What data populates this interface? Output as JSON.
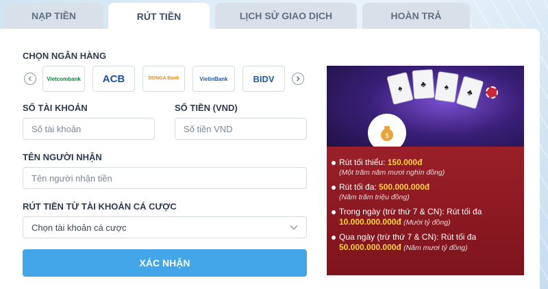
{
  "tabs": [
    {
      "label": "NẠP TIỀN",
      "active": false
    },
    {
      "label": "RÚT TIỀN",
      "active": true
    },
    {
      "label": "LỊCH SỬ GIAO DỊCH",
      "active": false
    },
    {
      "label": "HOÀN TRẢ",
      "active": false
    }
  ],
  "bank_section": {
    "label": "CHỌN NGÂN HÀNG",
    "banks": [
      {
        "name": "Vietcombank",
        "color": "#1a7a3c"
      },
      {
        "name": "ACB",
        "color": "#1f4fa3"
      },
      {
        "name": "DONGA Bank",
        "color": "#e88a18"
      },
      {
        "name": "VietinBank",
        "color": "#1c5aa8"
      },
      {
        "name": "BIDV",
        "color": "#1d5aa7"
      }
    ]
  },
  "form": {
    "account_number": {
      "label": "SỐ TÀI KHOẢN",
      "placeholder": "Số tài khoản"
    },
    "amount": {
      "label": "SỐ TIỀN (VND)",
      "placeholder": "Số tiền VND"
    },
    "recipient": {
      "label": "TÊN NGƯỜI NHẬN",
      "placeholder": "Tên người nhận tiền"
    },
    "source_account": {
      "label": "RÚT TIỀN TỪ TÀI KHOẢN CÁ CƯỢC",
      "selected": "Chọn tài khoản cá cược"
    },
    "submit_label": "XÁC NHẬN"
  },
  "promo": {
    "rules": [
      {
        "text": "Rút tối thiểu: ",
        "value": "150.000đ",
        "note": "(Một trăm năm mươi nghìn đồng)"
      },
      {
        "text": "Rút tối đa: ",
        "value": "500.000.000đ",
        "note": "(Năm trăm triệu đồng)"
      },
      {
        "text": "Trong ngày (trừ thứ 7 & CN): Rút tối đa",
        "value": "10.000.000.000đ",
        "note": "(Mười tỷ đồng)"
      },
      {
        "text": "Qua ngày (trừ thứ 7 & CN): Rút tối đa",
        "value": "50.000.000.000đ",
        "note": "(Năm mươi tỷ đồng)"
      }
    ]
  },
  "colors": {
    "accent": "#42a6e8",
    "promo_bg": "#8c1a22",
    "highlight": "#ffd23c"
  }
}
